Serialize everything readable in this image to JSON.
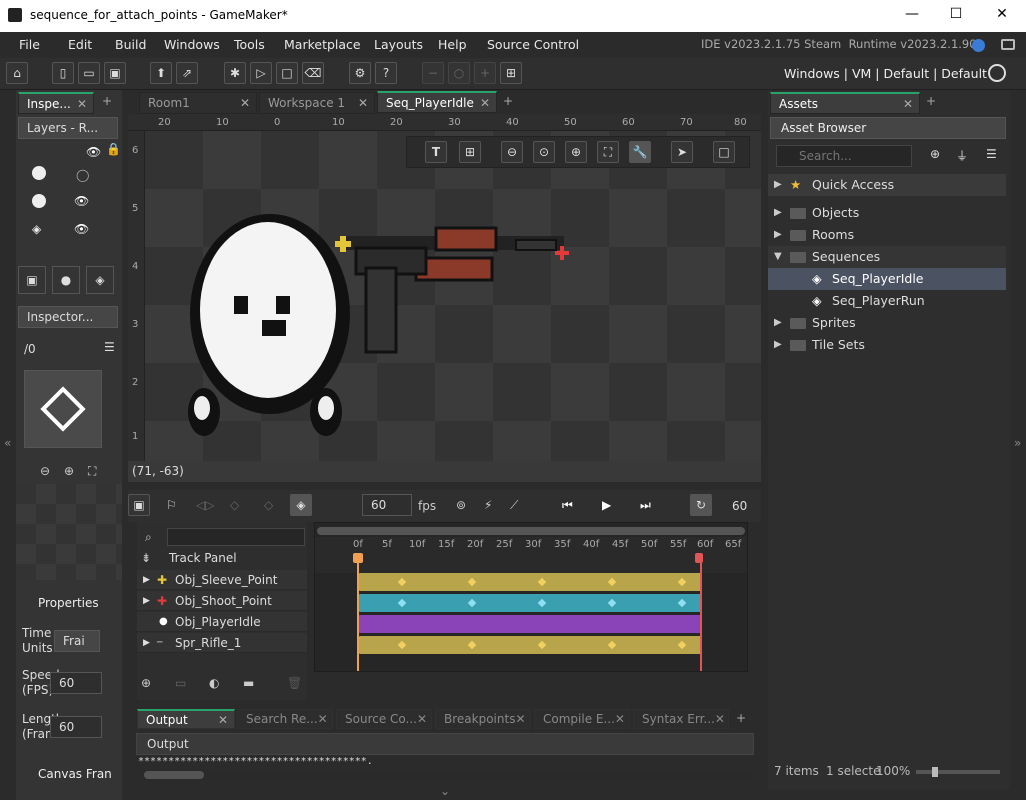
{
  "window": {
    "title": "sequence_for_attach_points - GameMaker*",
    "minimize": "—",
    "maximize": "☐",
    "close": "✕"
  },
  "menu": [
    "File",
    "Edit",
    "Build",
    "Windows",
    "Tools",
    "Marketplace",
    "Layouts",
    "Help",
    "Source Control"
  ],
  "version": "IDE v2023.2.1.75 Steam  Runtime v2023.2.1.90",
  "layout_bar": "Windows | VM | Default | Default",
  "left_panel": {
    "tab": "Inspe...",
    "layers_dropdown": "Layers - R...",
    "inspector_dropdown": "Inspector...",
    "frame_field": "/0",
    "properties_header": "Properties",
    "time_units_label": "Time Units",
    "time_units_value": "Frai",
    "speed_label": "Speed (FPS)",
    "speed_value": "60",
    "length_label": "Length (Fran",
    "length_value": "60",
    "canvas_frame_header": "Canvas Fran"
  },
  "doc_tabs": [
    {
      "label": "Room1",
      "active": false
    },
    {
      "label": "Workspace 1",
      "active": false
    },
    {
      "label": "Seq_PlayerIdle",
      "active": true
    }
  ],
  "canvas": {
    "ruler_top": [
      "20",
      "10",
      "0",
      "10",
      "20",
      "30",
      "40",
      "50",
      "60",
      "70",
      "80"
    ],
    "ruler_left": [
      "6",
      "5",
      "4",
      "3",
      "2",
      "1"
    ],
    "coords": "(71, -63)"
  },
  "timeline": {
    "fps_value": "60",
    "fps_label": "fps",
    "length_value": "60",
    "frame_labels": [
      "0f",
      "5f",
      "10f",
      "15f",
      "20f",
      "25f",
      "30f",
      "35f",
      "40f",
      "45f",
      "50f",
      "55f",
      "60f",
      "65f"
    ],
    "track_panel_label": "Track Panel",
    "tracks": [
      {
        "name": "Obj_Sleeve_Point",
        "color": "#b8a44a",
        "icon": "yellow-cross-icon"
      },
      {
        "name": "Obj_Shoot_Point",
        "color": "#3a9fb0",
        "icon": "red-cross-icon"
      },
      {
        "name": "Obj_PlayerIdle",
        "color": "#8a44b8",
        "icon": "player-icon"
      },
      {
        "name": "Spr_Rifle_1",
        "color": "#b8a44a",
        "icon": "rifle-icon"
      }
    ]
  },
  "output": {
    "tabs": [
      "Output",
      "Search Re...",
      "Source Co...",
      "Breakpoints",
      "Compile E...",
      "Syntax Err..."
    ],
    "header": "Output",
    "text": "**************************************."
  },
  "assets": {
    "tab": "Assets",
    "browser_label": "Asset Browser",
    "search_placeholder": "Search...",
    "quick_access": "Quick Access",
    "tree": [
      {
        "label": "Objects",
        "level": 0,
        "expanded": false
      },
      {
        "label": "Rooms",
        "level": 0,
        "expanded": false
      },
      {
        "label": "Sequences",
        "level": 0,
        "expanded": true
      },
      {
        "label": "Seq_PlayerIdle",
        "level": 1,
        "selected": true
      },
      {
        "label": "Seq_PlayerRun",
        "level": 1
      },
      {
        "label": "Sprites",
        "level": 0,
        "expanded": false
      },
      {
        "label": "Tile Sets",
        "level": 0,
        "expanded": false
      }
    ],
    "status_items": "7 items",
    "status_selected": "1 selecte",
    "status_zoom": "100%"
  },
  "colors": {
    "accent": "#28a36a",
    "selection": "#4b5362",
    "playhead": "#f0a050",
    "endmark": "#e05555"
  }
}
